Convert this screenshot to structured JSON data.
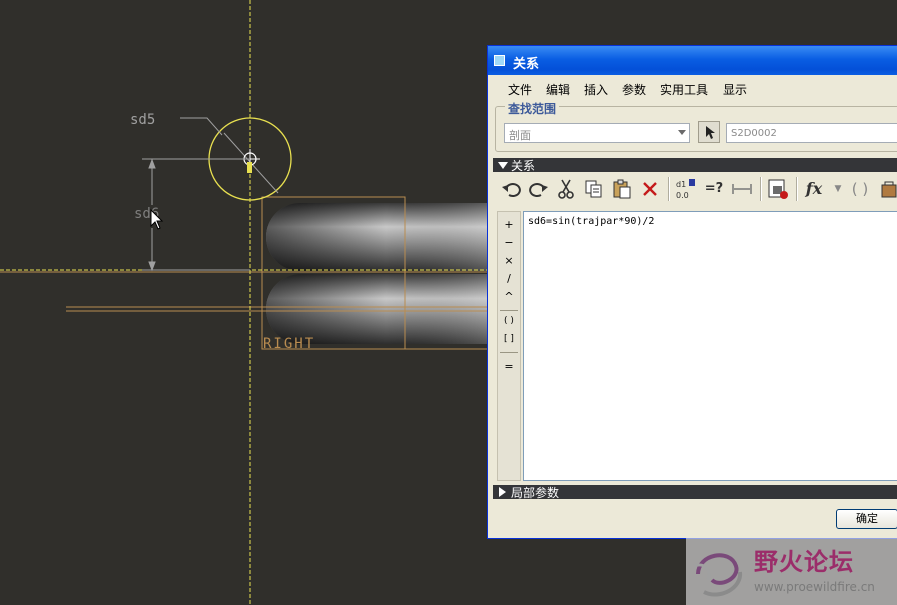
{
  "viewport": {
    "dimension_text": "sd5",
    "datum_label": "RIGHT",
    "colors": {
      "background": "#302f2b",
      "axis": "#e8e050",
      "datum": "#b98c50",
      "dim": "#a0a0a0"
    }
  },
  "dialog": {
    "title": "关系",
    "menu": [
      "文件",
      "编辑",
      "插入",
      "参数",
      "实用工具",
      "显示"
    ],
    "search_scope": {
      "legend": "查找范围",
      "scope_value": "剖面",
      "target_value": "S2D0002"
    },
    "relations_section": "关系",
    "toolbar_icons": [
      "undo-icon",
      "redo-icon",
      "cut-icon",
      "copy-icon",
      "paste-icon",
      "delete-icon",
      "sort-icon",
      "evaluate-icon",
      "measure-icon",
      "insert-param-icon",
      "function-icon",
      "parenthesis-icon",
      "unit-icon"
    ],
    "toolbar_labels": {
      "evaluate": "=?",
      "function": "fx",
      "parenthesis": "( )"
    },
    "operators": [
      "+",
      "−",
      "×",
      "/",
      "^",
      "( )",
      "[ ]",
      "="
    ],
    "relation_text": "sd6=sin(trajpar*90)/2",
    "local_params_section": "局部参数",
    "ok_label": "确定"
  },
  "watermark": {
    "name": "野火论坛",
    "url": "www.proewildfire.cn"
  }
}
